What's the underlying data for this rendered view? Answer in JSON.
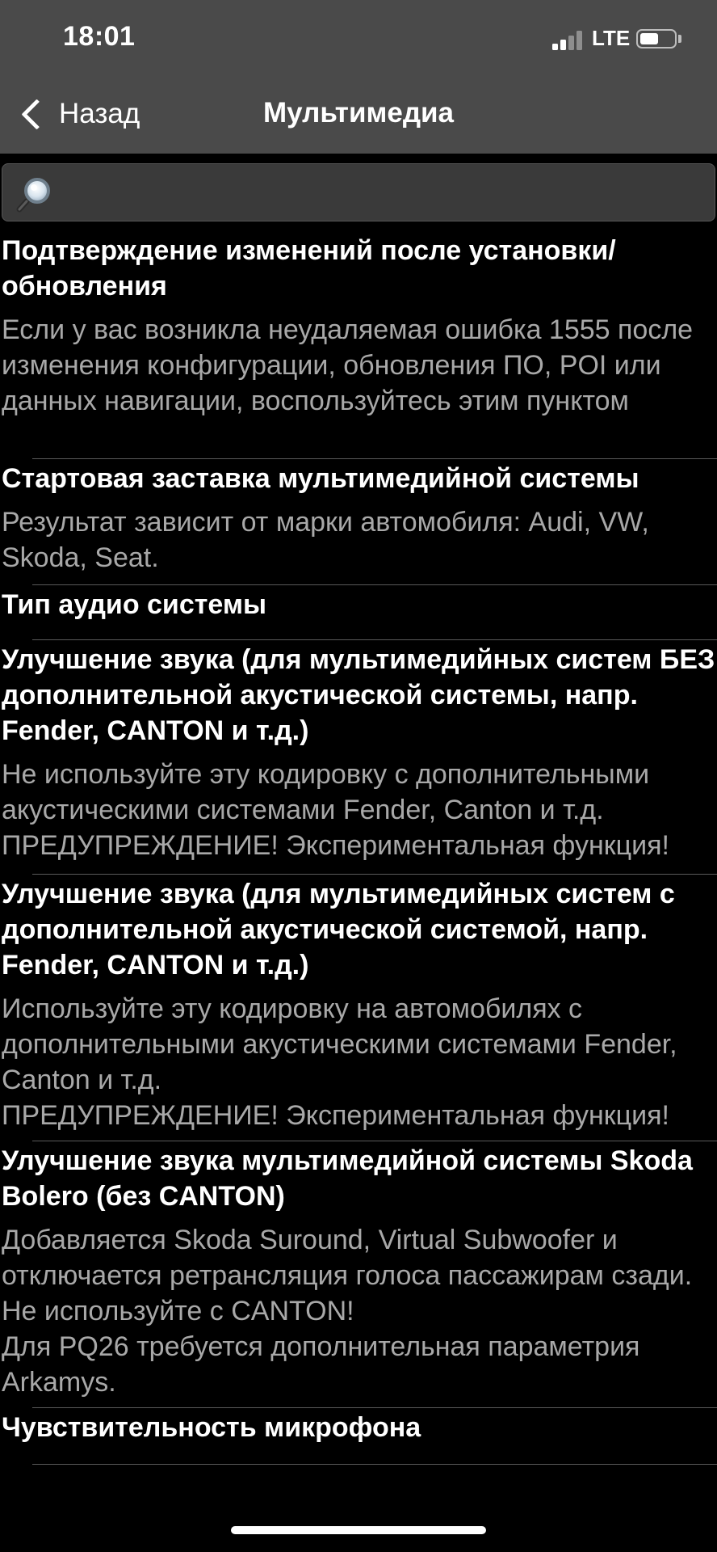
{
  "status_bar": {
    "time": "18:01",
    "network": "LTE",
    "signal_bars_active": 2,
    "signal_bars_total": 4,
    "battery_level_percent": 40
  },
  "nav": {
    "back_label": "Назад",
    "title": "Мультимедиа"
  },
  "search": {
    "value": "",
    "placeholder": ""
  },
  "items": [
    {
      "title": "Подтверждение изменений после установки/обновления",
      "description": "Если у вас возникла неудаляемая ошибка 1555 после изменения конфигурации, обновления ПО, POI или данных навигации, воспользуйтесь этим пунктом"
    },
    {
      "title": "Стартовая заставка мультимедийной системы",
      "description": "Результат зависит от марки автомобиля: Audi, VW, Skoda, Seat."
    },
    {
      "title": "Тип аудио системы",
      "description": ""
    },
    {
      "title": "Улучшение звука (для мультимедийных систем БЕЗ дополнительной акустической системы, напр. Fender, CANTON и т.д.)",
      "description": "Не используйте эту кодировку с дополнительными акустическими системами Fender, Canton и т.д.\nПРЕДУПРЕЖДЕНИЕ! Экспериментальная функция!"
    },
    {
      "title": "Улучшение звука (для мультимедийных систем с дополнительной акустической системой, напр. Fender, CANTON и т.д.)",
      "description": "Используйте эту кодировку на автомобилях с дополнительными акустическими системами Fender, Canton и т.д.\nПРЕДУПРЕЖДЕНИЕ! Экспериментальная функция!"
    },
    {
      "title": "Улучшение звука мультимедийной системы Skoda Bolero (без CANTON)",
      "description": "Добавляется Skoda Suround, Virtual Subwoofer и отключается ретрансляция голоса пассажирам сзади. Не используйте с CANTON!\nДля PQ26 требуется дополнительная параметрия Arkamys."
    },
    {
      "title": "Чувствительность микрофона",
      "description": ""
    }
  ]
}
